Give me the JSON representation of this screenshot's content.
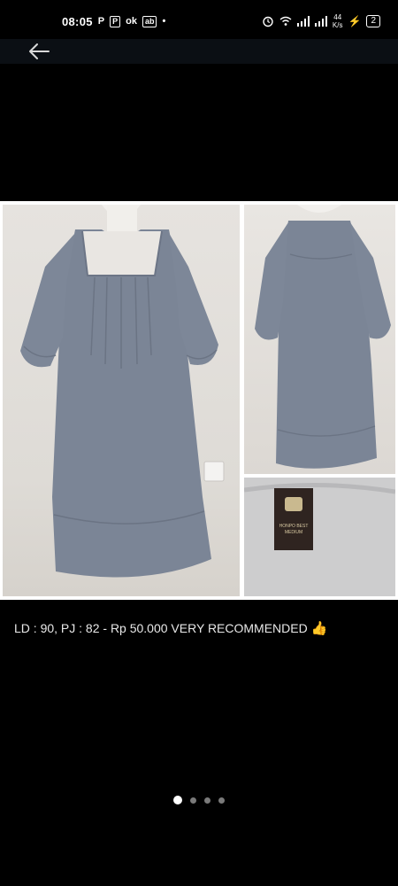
{
  "status_bar": {
    "time": "08:05",
    "notif_icons": [
      "P",
      "P",
      "ok",
      "ab",
      "•"
    ],
    "network_speed_value": "44",
    "network_speed_unit": "K/s",
    "battery": "2"
  },
  "product": {
    "caption": "LD : 90, PJ : 82 - Rp 50.000 VERY RECOMMENDED",
    "caption_emoji": "👍",
    "label_text_line1": "HONPO BEST",
    "label_text_line2": "MEDIUM"
  },
  "gallery": {
    "total_pages": 4,
    "current_page": 1
  },
  "colors": {
    "background": "#000000",
    "dress": "#7b8596",
    "frame": "#ffffff"
  }
}
